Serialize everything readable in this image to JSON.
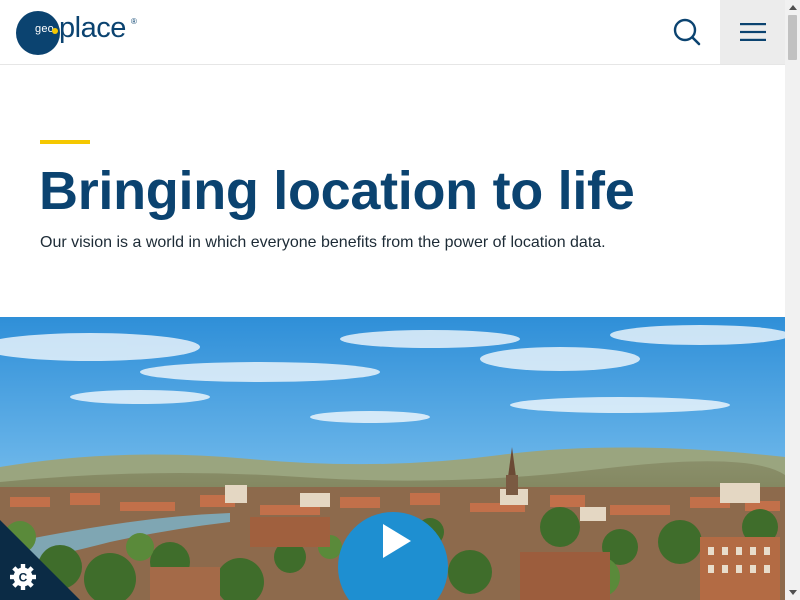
{
  "header": {
    "logo": {
      "geo": "geo",
      "place": "place",
      "reg": "®"
    },
    "search_icon": "search-icon",
    "menu_icon": "hamburger-menu-icon"
  },
  "hero": {
    "title": "Bringing location to life",
    "subtitle": "Our vision is a world in which everyone benefits from the power of location data."
  },
  "media": {
    "image": "city-panorama",
    "play_icon": "play-icon"
  },
  "cookie": {
    "icon": "cookie-settings-icon"
  },
  "colors": {
    "brand_navy": "#0b4370",
    "accent_yellow": "#f5c800",
    "play_blue": "#1e8fd1",
    "menu_bg": "#ececec"
  }
}
